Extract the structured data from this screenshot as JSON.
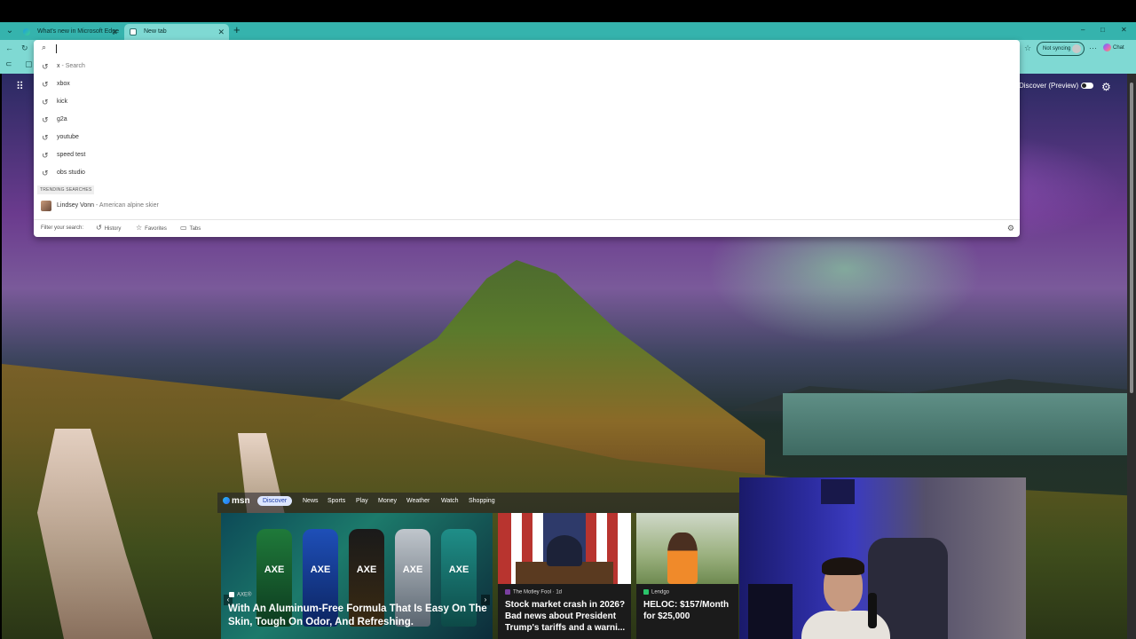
{
  "tabs": [
    {
      "label": "What's new in Microsoft Edge",
      "active": false
    },
    {
      "label": "New tab",
      "active": true
    }
  ],
  "toolbar": {
    "sync_label": "Not syncing",
    "chat_label": "Chat"
  },
  "omnibox": {
    "value": "",
    "suggestions": [
      {
        "text": "x",
        "sub": " - Search"
      },
      {
        "text": "xbox",
        "sub": ""
      },
      {
        "text": "kick",
        "sub": ""
      },
      {
        "text": "g2a",
        "sub": ""
      },
      {
        "text": "youtube",
        "sub": ""
      },
      {
        "text": "speed test",
        "sub": ""
      },
      {
        "text": "obs studio",
        "sub": ""
      }
    ],
    "trending_label": "TRENDING SEARCHES",
    "trending": {
      "text": "Lindsey Vonn",
      "sub": " - American alpine skier"
    },
    "filter_label": "Filter your search:",
    "filters": [
      "History",
      "Favorites",
      "Tabs"
    ]
  },
  "page": {
    "discover_label": "Discover (Preview)"
  },
  "msn": {
    "logo": "msn",
    "nav": [
      "Discover",
      "News",
      "Sports",
      "Play",
      "Money",
      "Weather",
      "Watch",
      "Shopping"
    ],
    "cards": [
      {
        "source": "AXE®",
        "title": "With An Aluminum-Free Formula That Is Easy On The Skin, Tough On Odor, And Refreshing."
      },
      {
        "source": "The Motley Fool · 1d",
        "title": "Stock market crash in 2026? Bad news about President Trump's tariffs and a warni..."
      },
      {
        "source": "Lendgo",
        "title": "HELOC: $157/Month for $25,000"
      }
    ],
    "cans": [
      "AXE",
      "AXE",
      "AXE",
      "AXE",
      "AXE"
    ]
  },
  "colors": {
    "tab_strip": "#35b3ad",
    "toolbar": "#7fd9d3",
    "msn_active": "#dde6ff"
  }
}
